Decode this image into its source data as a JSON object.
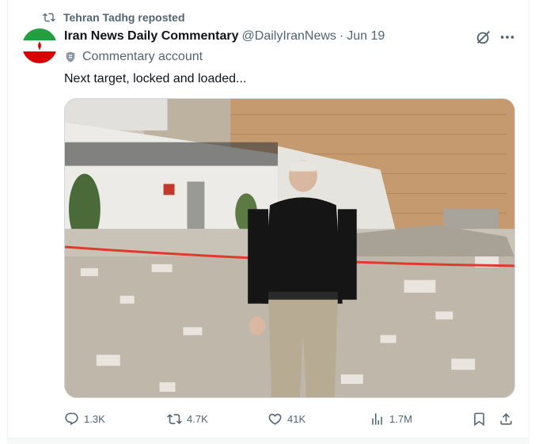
{
  "repost": {
    "label": "Tehran Tadhg reposted",
    "icon": "repost-icon"
  },
  "author": {
    "display_name": "Iran News Daily Commentary",
    "handle": "@DailyIranNews",
    "separator": "·",
    "date": "Jun 19",
    "avatar_icon": "iran-flag-avatar"
  },
  "badge": {
    "icon": "shield-icon",
    "label": "Commentary account"
  },
  "tweet": {
    "text": "Next target, locked and loaded..."
  },
  "media": {
    "description_icon": "photo-man-standing-in-rubble"
  },
  "actions": {
    "replies": {
      "icon": "reply-icon",
      "count": "1.3K"
    },
    "reposts": {
      "icon": "repost-icon",
      "count": "4.7K"
    },
    "likes": {
      "icon": "like-icon",
      "count": "41K"
    },
    "views": {
      "icon": "views-icon",
      "count": "1.7M"
    },
    "bookmark": {
      "icon": "bookmark-icon"
    },
    "share": {
      "icon": "share-icon"
    }
  },
  "header_icons": {
    "grok": "grok-icon",
    "more": "more-icon"
  },
  "colors": {
    "text_primary": "#0f1419",
    "text_secondary": "#536471",
    "border": "#cfd9de"
  }
}
